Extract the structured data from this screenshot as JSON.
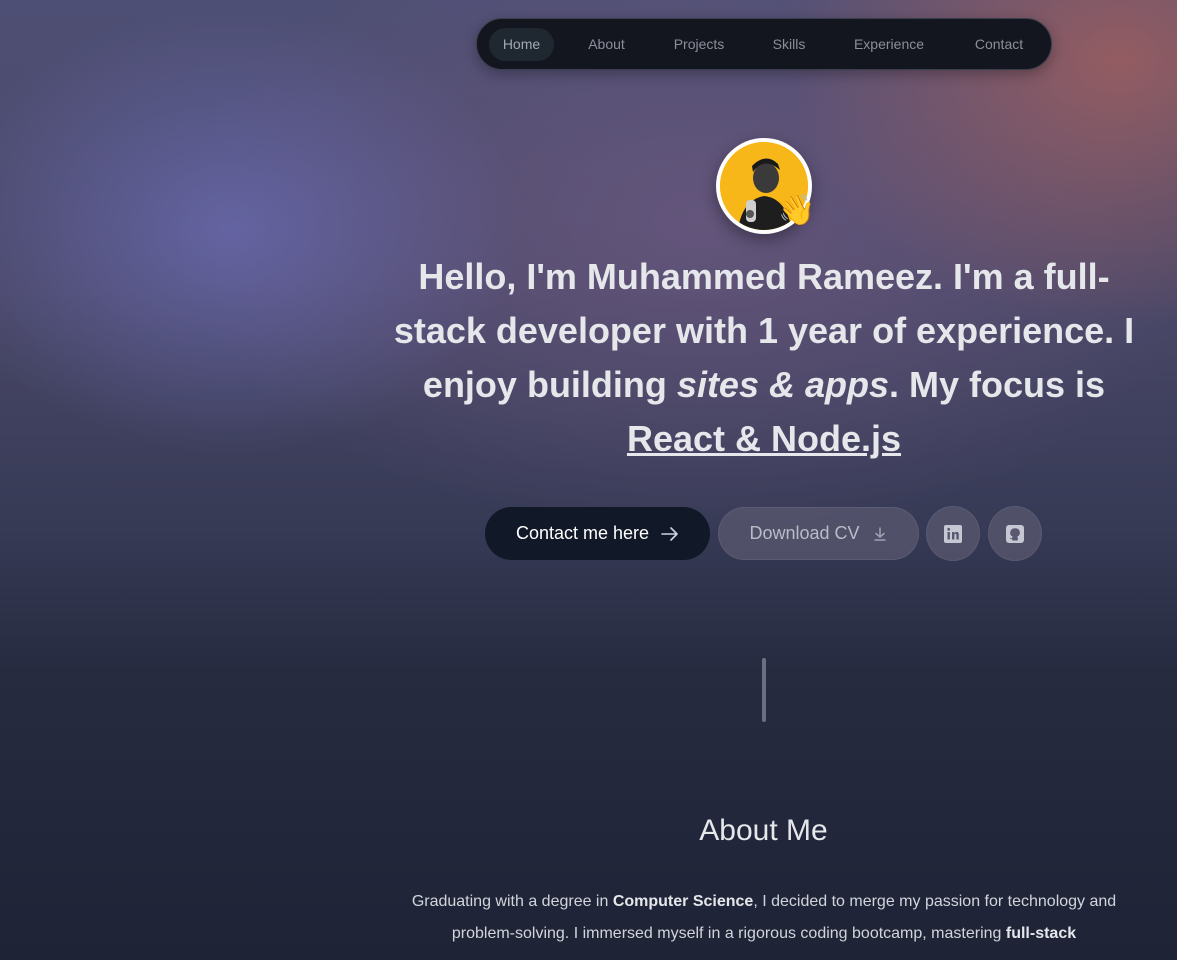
{
  "nav": {
    "items": [
      {
        "label": "Home",
        "active": true
      },
      {
        "label": "About",
        "active": false
      },
      {
        "label": "Projects",
        "active": false
      },
      {
        "label": "Skills",
        "active": false
      },
      {
        "label": "Experience",
        "active": false
      },
      {
        "label": "Contact",
        "active": false
      }
    ]
  },
  "hero": {
    "greeting": "Hello, I'm Muhammed Rameez.",
    "t1": " I'm a ",
    "role": "full-stack developer",
    "t2": " with ",
    "experience": "1 year",
    "t3": " of experience. I enjoy building ",
    "build": "sites & apps",
    "t4": ". My focus is ",
    "focus": "React & Node.js",
    "wave_emoji": "👋"
  },
  "buttons": {
    "contact_label": "Contact me here",
    "cv_label": "Download CV",
    "contact_icon": "arrow-right-icon",
    "cv_icon": "download-icon",
    "linkedin_icon": "linkedin-icon",
    "github_icon": "github-icon"
  },
  "about": {
    "title": "About Me",
    "p1": "Graduating with a degree in ",
    "degree": "Computer Science",
    "p2": ", I decided to merge my passion for technology and problem-solving. I immersed myself in a rigorous coding bootcamp, mastering ",
    "skill": "full-stack"
  },
  "colors": {
    "primary_button": "#111827",
    "nav_bg": "#13161f",
    "avatar_bg": "#f7b718"
  }
}
